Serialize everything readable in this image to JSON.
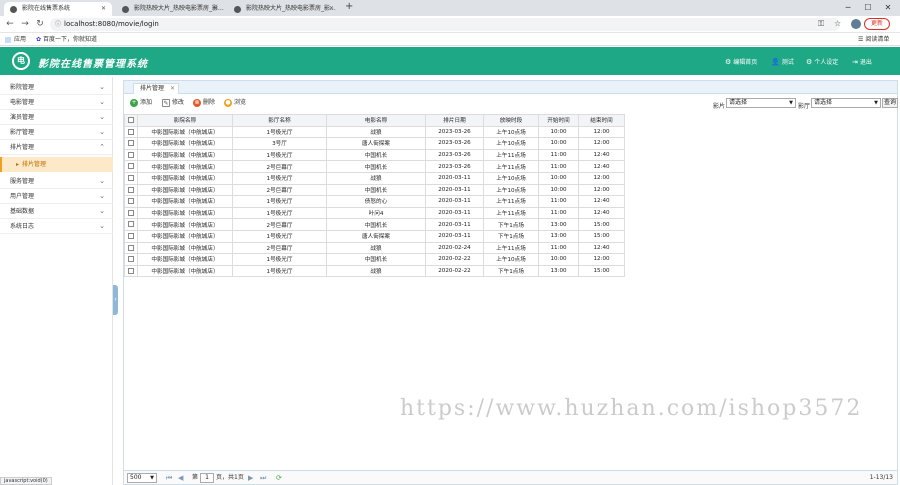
{
  "browser": {
    "tabs": [
      {
        "title": "影院在线售票系统"
      },
      {
        "title": "影院热映大片_热映电影票房_影..."
      },
      {
        "title": "影院热映大片_热映电影票房_影..."
      }
    ],
    "url": "localhost:8080/movie/login",
    "update_label": "更新",
    "bookmarks": {
      "apps": "应用",
      "baidu": "百度一下，你就知道",
      "reading_list": "阅读清单"
    },
    "status_text": "javascript:void(0)"
  },
  "app": {
    "logo_glyph": "电",
    "title": "影院在线售票管理系统",
    "header_links": [
      {
        "icon": "gear-icon",
        "label": "编辑首页"
      },
      {
        "icon": "user-icon",
        "label": "测试"
      },
      {
        "icon": "gear-icon",
        "label": "个人设定"
      },
      {
        "icon": "exit-icon",
        "label": "退出"
      }
    ],
    "accent_color": "#1ea886"
  },
  "sidebar": {
    "items": [
      {
        "label": "影院管理"
      },
      {
        "label": "电影管理"
      },
      {
        "label": "演员管理"
      },
      {
        "label": "影厅管理"
      },
      {
        "label": "排片管理",
        "expanded": true
      },
      {
        "label": "服务管理"
      },
      {
        "label": "用户管理"
      },
      {
        "label": "基础数据"
      },
      {
        "label": "系统日志"
      }
    ],
    "active_sub": "排片管理"
  },
  "main": {
    "tab": "排片管理",
    "toolbar": {
      "add": "添加",
      "edit": "修改",
      "delete": "删除",
      "view": "浏览"
    },
    "filters": {
      "film_label": "影片",
      "film_value": "请选择",
      "hall_label": "影厅",
      "hall_value": "请选择",
      "query": "查询"
    },
    "columns": [
      "影院名称",
      "影厅名称",
      "电影名称",
      "排片日期",
      "放映时段",
      "开始时间",
      "结束时间"
    ],
    "rows": [
      [
        "中影国际影城（中航城店）",
        "1号极光厅",
        "战狼",
        "2023-03-26",
        "上午10点场",
        "10:00",
        "12:00"
      ],
      [
        "中影国际影城（中航城店）",
        "3号厅",
        "唐人街探案",
        "2023-03-26",
        "上午10点场",
        "10:00",
        "12:00"
      ],
      [
        "中影国际影城（中航城店）",
        "1号极光厅",
        "中国机长",
        "2023-03-26",
        "上午11点场",
        "11:00",
        "12:40"
      ],
      [
        "中影国际影城（中航城店）",
        "2号巨幕厅",
        "中国机长",
        "2023-03-26",
        "上午11点场",
        "11:00",
        "12:40"
      ],
      [
        "中影国际影城（中航城店）",
        "1号极光厅",
        "战狼",
        "2020-03-11",
        "上午10点场",
        "10:00",
        "12:00"
      ],
      [
        "中影国际影城（中航城店）",
        "2号巨幕厅",
        "中国机长",
        "2020-03-11",
        "上午10点场",
        "10:00",
        "12:00"
      ],
      [
        "中影国际影城（中航城店）",
        "1号极光厅",
        "债怒的心",
        "2020-03-11",
        "上午11点场",
        "11:00",
        "12:40"
      ],
      [
        "中影国际影城（中航城店）",
        "1号极光厅",
        "叶问4",
        "2020-03-11",
        "上午11点场",
        "11:00",
        "12:40"
      ],
      [
        "中影国际影城（中航城店）",
        "2号巨幕厅",
        "中国机长",
        "2020-03-11",
        "下午1点场",
        "13:00",
        "15:00"
      ],
      [
        "中影国际影城（中航城店）",
        "1号极光厅",
        "唐人街探案",
        "2020-03-11",
        "下午1点场",
        "13:00",
        "15:00"
      ],
      [
        "中影国际影城（中航城店）",
        "2号巨幕厅",
        "战狼",
        "2020-02-24",
        "上午11点场",
        "11:00",
        "12:40"
      ],
      [
        "中影国际影城（中航城店）",
        "1号极光厅",
        "中国机长",
        "2020-02-22",
        "上午10点场",
        "10:00",
        "12:00"
      ],
      [
        "中影国际影城（中航城店）",
        "1号极光厅",
        "战狼",
        "2020-02-22",
        "下午1点场",
        "13:00",
        "15:00"
      ]
    ],
    "pager": {
      "page_size": "500",
      "page_prefix": "第",
      "page": "1",
      "page_suffix": "页，共1页",
      "range": "1-13/13"
    }
  },
  "watermark": "https://www.huzhan.com/ishop3572"
}
